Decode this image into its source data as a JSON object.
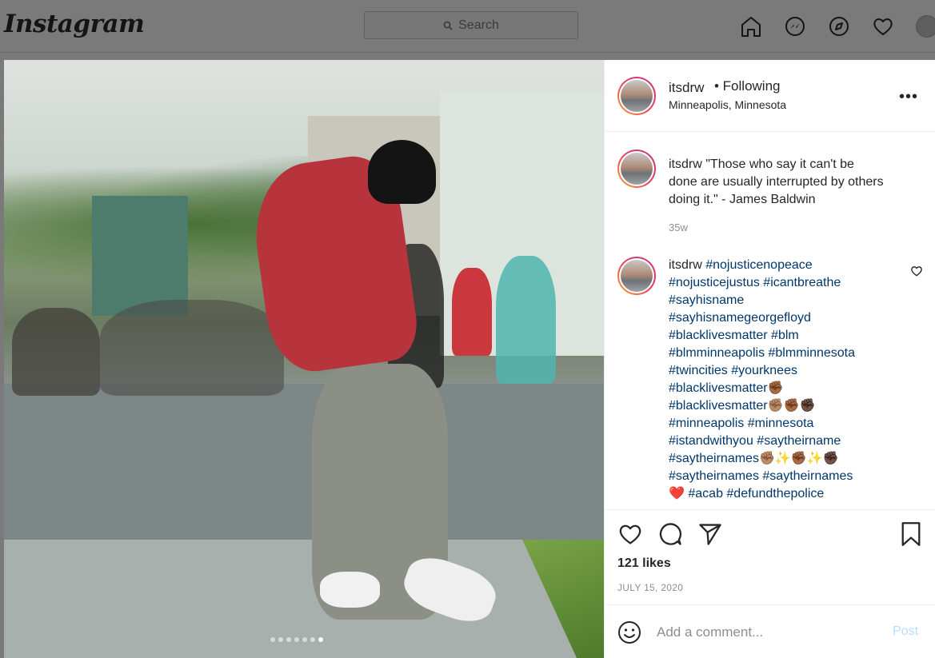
{
  "nav": {
    "logo": "Instagram",
    "search_placeholder": "Search",
    "icons": [
      "home-icon",
      "messenger-icon",
      "explore-icon",
      "activity-heart-icon",
      "profile-avatar"
    ]
  },
  "post": {
    "username": "itsdrw",
    "follow_status": "• Following",
    "location": "Minneapolis, Minnesota",
    "carousel": {
      "dots": 7,
      "active_index": 6
    },
    "caption_comment": {
      "username": "itsdrw",
      "text": "\"Those who say it can't be done are usually interrupted by others doing it.\" - James Baldwin",
      "time": "35w"
    },
    "hashtag_comment": {
      "username": "itsdrw",
      "lines": [
        "#nojusticenopeace",
        "#nojusticejustus #icantbreathe",
        "#sayhisname",
        "#sayhisnamegeorgefloyd",
        "#blacklivesmatter #blm",
        "#blmminneapolis #blmminnesota",
        "#twincities #yourknees",
        "#blacklivesmatter✊🏾",
        "#blacklivesmatter✊🏽✊🏾✊🏿",
        "#minneapolis #minnesota",
        "#istandwithyou #saytheirname",
        "#saytheirnames✊🏽✨✊🏾✨✊🏿",
        "#saytheirnames #saytheirnames",
        "❤️ #acab #defundthepolice"
      ]
    },
    "likes": "121 likes",
    "date": "JULY 15, 2020",
    "comment_placeholder": "Add a comment...",
    "post_label": "Post"
  },
  "colors": {
    "link": "#00376b",
    "muted": "#8e8e8e",
    "post_disabled": "#b2dffc"
  }
}
